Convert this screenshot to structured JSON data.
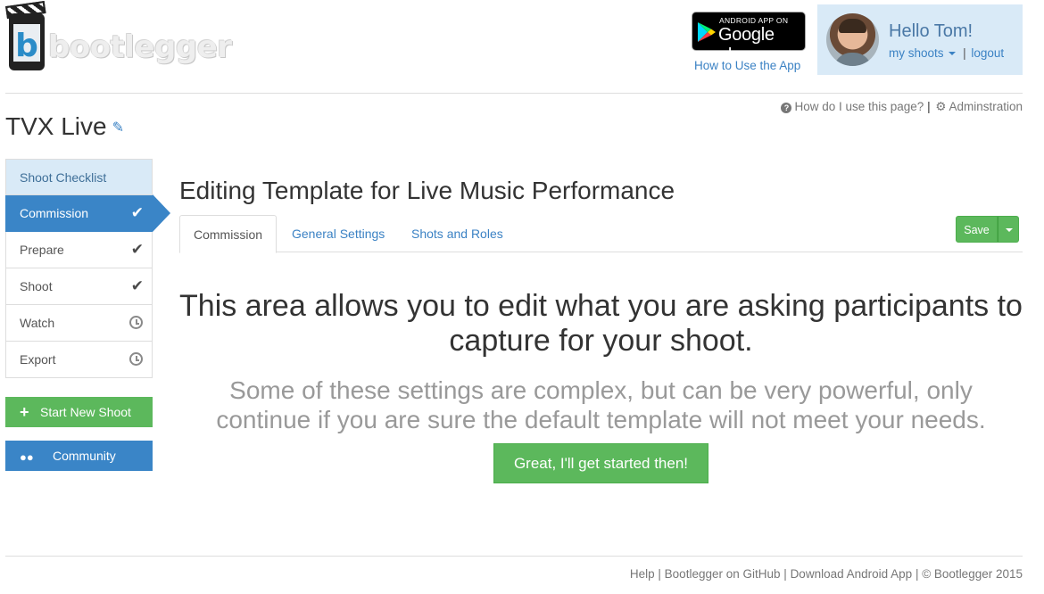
{
  "brand": {
    "logo_text": "bootlegger",
    "logo_letter": "b"
  },
  "header": {
    "store_badge_small": "ANDROID APP ON",
    "store_badge_big": "Google play",
    "how_to_link": "How to Use the App",
    "greeting": "Hello Tom!",
    "my_shoots_link": "my shoots",
    "divider": "|",
    "logout_link": "logout"
  },
  "help_bar": {
    "help_link": "How do I use this page?",
    "divider": "|",
    "admin_link": "Adminstration"
  },
  "page": {
    "title": "TVX Live"
  },
  "steps": [
    {
      "label": "Shoot Checklist",
      "state": "header"
    },
    {
      "label": "Commission",
      "state": "active-done"
    },
    {
      "label": "Prepare",
      "state": "done"
    },
    {
      "label": "Shoot",
      "state": "done"
    },
    {
      "label": "Watch",
      "state": "pending"
    },
    {
      "label": "Export",
      "state": "pending"
    }
  ],
  "sidebar_buttons": {
    "start_new_shoot": "Start New Shoot",
    "community": "Community"
  },
  "main": {
    "title": "Editing Template for Live Music Performance",
    "tabs": [
      {
        "label": "Commission",
        "active": true
      },
      {
        "label": "General Settings",
        "active": false
      },
      {
        "label": "Shots and Roles",
        "active": false
      }
    ],
    "save_label": "Save",
    "lead": "This area allows you to edit what you are asking participants to capture for your shoot.",
    "sub": "Some of these settings are complex, but can be very powerful, only continue if you are sure the default template will not meet your needs.",
    "cta": "Great, I'll get started then!"
  },
  "footer": {
    "help": "Help",
    "github": "Bootlegger on GitHub",
    "android": "Download Android App",
    "copyright": "© Bootlegger 2015",
    "divider": "|"
  },
  "colors": {
    "primary": "#3a85c7",
    "success": "#5cb85c",
    "light_blue": "#d9eaf7",
    "link": "#3b82c4"
  },
  "icons": {
    "edit": "pencil-icon",
    "done": "check-icon",
    "pending": "clock-icon",
    "help": "question-circle-icon",
    "admin": "gear-icon",
    "add": "plus-icon",
    "community": "users-icon",
    "dropdown": "caret-down-icon"
  }
}
